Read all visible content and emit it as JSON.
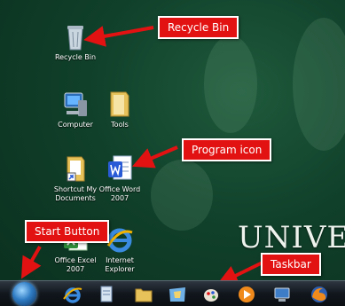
{
  "desktop": {
    "icons": [
      {
        "label": "Recycle Bin",
        "icon": "recycle-bin-icon"
      },
      {
        "label": "Computer",
        "icon": "computer-icon"
      },
      {
        "label": "Tools",
        "icon": "folder-icon"
      },
      {
        "label": "Shortcut My Documents",
        "icon": "documents-shortcut-icon"
      },
      {
        "label": "Office Word 2007",
        "icon": "word-icon"
      },
      {
        "label": "Office Excel 2007",
        "icon": "excel-icon"
      },
      {
        "label": "Internet Explorer",
        "icon": "internet-explorer-icon"
      }
    ],
    "wallpaper_text": "UNIVE"
  },
  "callouts": {
    "recycle_bin": "Recycle Bin",
    "program_icon": "Program icon",
    "start_button": "Start Button",
    "taskbar": "Taskbar"
  },
  "taskbar": {
    "buttons": [
      "internet-explorer-icon",
      "document-icon",
      "folder-icon",
      "windows-explorer-icon",
      "paint-icon",
      "media-player-icon",
      "computer-icon",
      "firefox-icon"
    ]
  },
  "colors": {
    "callout_red": "#e31212",
    "wallpaper_green": "#10402a"
  }
}
